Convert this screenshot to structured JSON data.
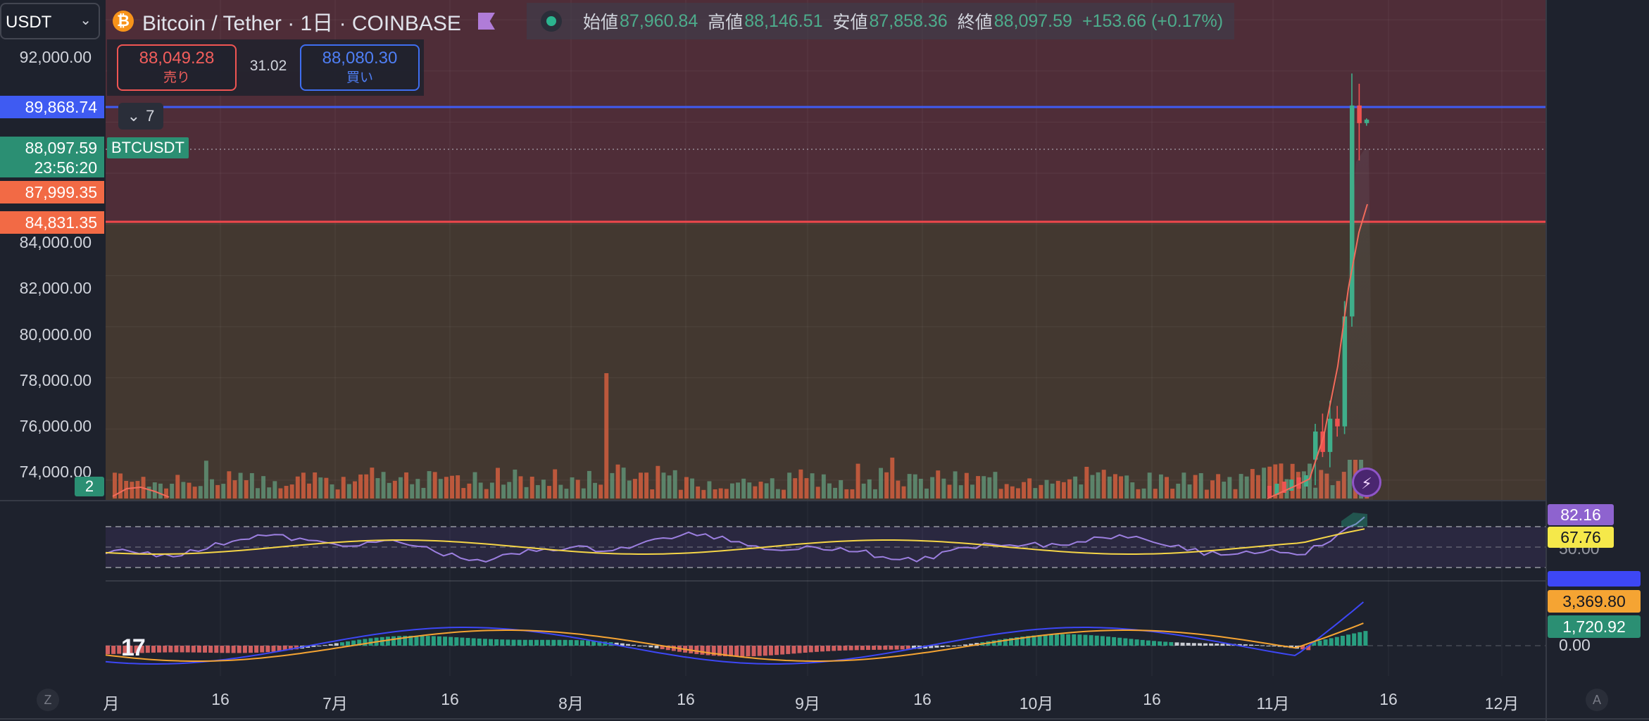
{
  "currency_select": {
    "value": "USDT"
  },
  "header": {
    "symbol_title": "Bitcoin / Tether · 1日 · COINBASE",
    "coin_glyph": "₿",
    "ohlc": {
      "open_label": "始値",
      "open": "87,960.84",
      "high_label": "高値",
      "high": "88,146.51",
      "low_label": "安値",
      "low": "87,858.36",
      "close_label": "終値",
      "close": "88,097.59",
      "change": "+153.66 (+0.17%)"
    }
  },
  "trade": {
    "sell_price": "88,049.28",
    "sell_label": "売り",
    "spread": "31.02",
    "buy_price": "88,080.30",
    "buy_label": "買い"
  },
  "collapse": {
    "count": "7"
  },
  "ticker_tag": "BTCUSDT",
  "price_axis": {
    "ticks": [
      "92,000.00",
      "84,000.00",
      "82,000.00",
      "80,000.00",
      "78,000.00",
      "76,000.00",
      "74,000.00"
    ],
    "badges": {
      "upper_line": "89,868.74",
      "last_price": "88,097.59",
      "countdown": "23:56:20",
      "prev_close": "87,999.35",
      "lower_line": "84,831.35"
    }
  },
  "rsi": {
    "value": "82.16",
    "ma": "67.76",
    "hidden_level": "50.00"
  },
  "macd": {
    "value": "3,369.80",
    "histogram": "1,720.92",
    "zero": "0.00"
  },
  "time_axis": [
    "月",
    "16",
    "7月",
    "16",
    "8月",
    "16",
    "9月",
    "16",
    "10月",
    "16",
    "11月",
    "16",
    "12月"
  ],
  "footer": {
    "left_button": "Z",
    "right_button": "A",
    "count_badge": "2",
    "bolt_glyph": "⚡"
  },
  "colors": {
    "background": "#1e222d",
    "bull": "#26a69a",
    "bear": "#ef5350",
    "blue_line": "#3f5bf2",
    "red_line": "#f0474c",
    "rsi_line": "#9c7fe0",
    "ma_line": "#f5d547",
    "macd_line": "#3d47f5",
    "signal_line": "#f5a433"
  },
  "chart_data": {
    "type": "candlestick",
    "symbol": "BTCUSDT",
    "interval": "1D",
    "y_range": [
      73500,
      92500
    ],
    "overlay_lines": [
      89868.74,
      84831.35
    ],
    "last_price": 88097.59,
    "recent_candles": [
      {
        "o": 74800,
        "h": 76200,
        "l": 73800,
        "c": 75900
      },
      {
        "o": 75900,
        "h": 76600,
        "l": 74900,
        "c": 75100
      },
      {
        "o": 75100,
        "h": 77100,
        "l": 74500,
        "c": 76400
      },
      {
        "o": 76400,
        "h": 76900,
        "l": 75700,
        "c": 76100
      },
      {
        "o": 76100,
        "h": 81000,
        "l": 75800,
        "c": 80400
      },
      {
        "o": 80400,
        "h": 89900,
        "l": 80000,
        "c": 88650
      },
      {
        "o": 88650,
        "h": 89500,
        "l": 86500,
        "c": 87960
      },
      {
        "o": 87960,
        "h": 88146,
        "l": 87858,
        "c": 88097
      }
    ],
    "rsi": {
      "value": 82.16,
      "ma": 67.76,
      "levels": [
        70,
        50,
        30
      ]
    },
    "macd": {
      "macd": 3369.8,
      "histogram": 1720.92
    }
  }
}
